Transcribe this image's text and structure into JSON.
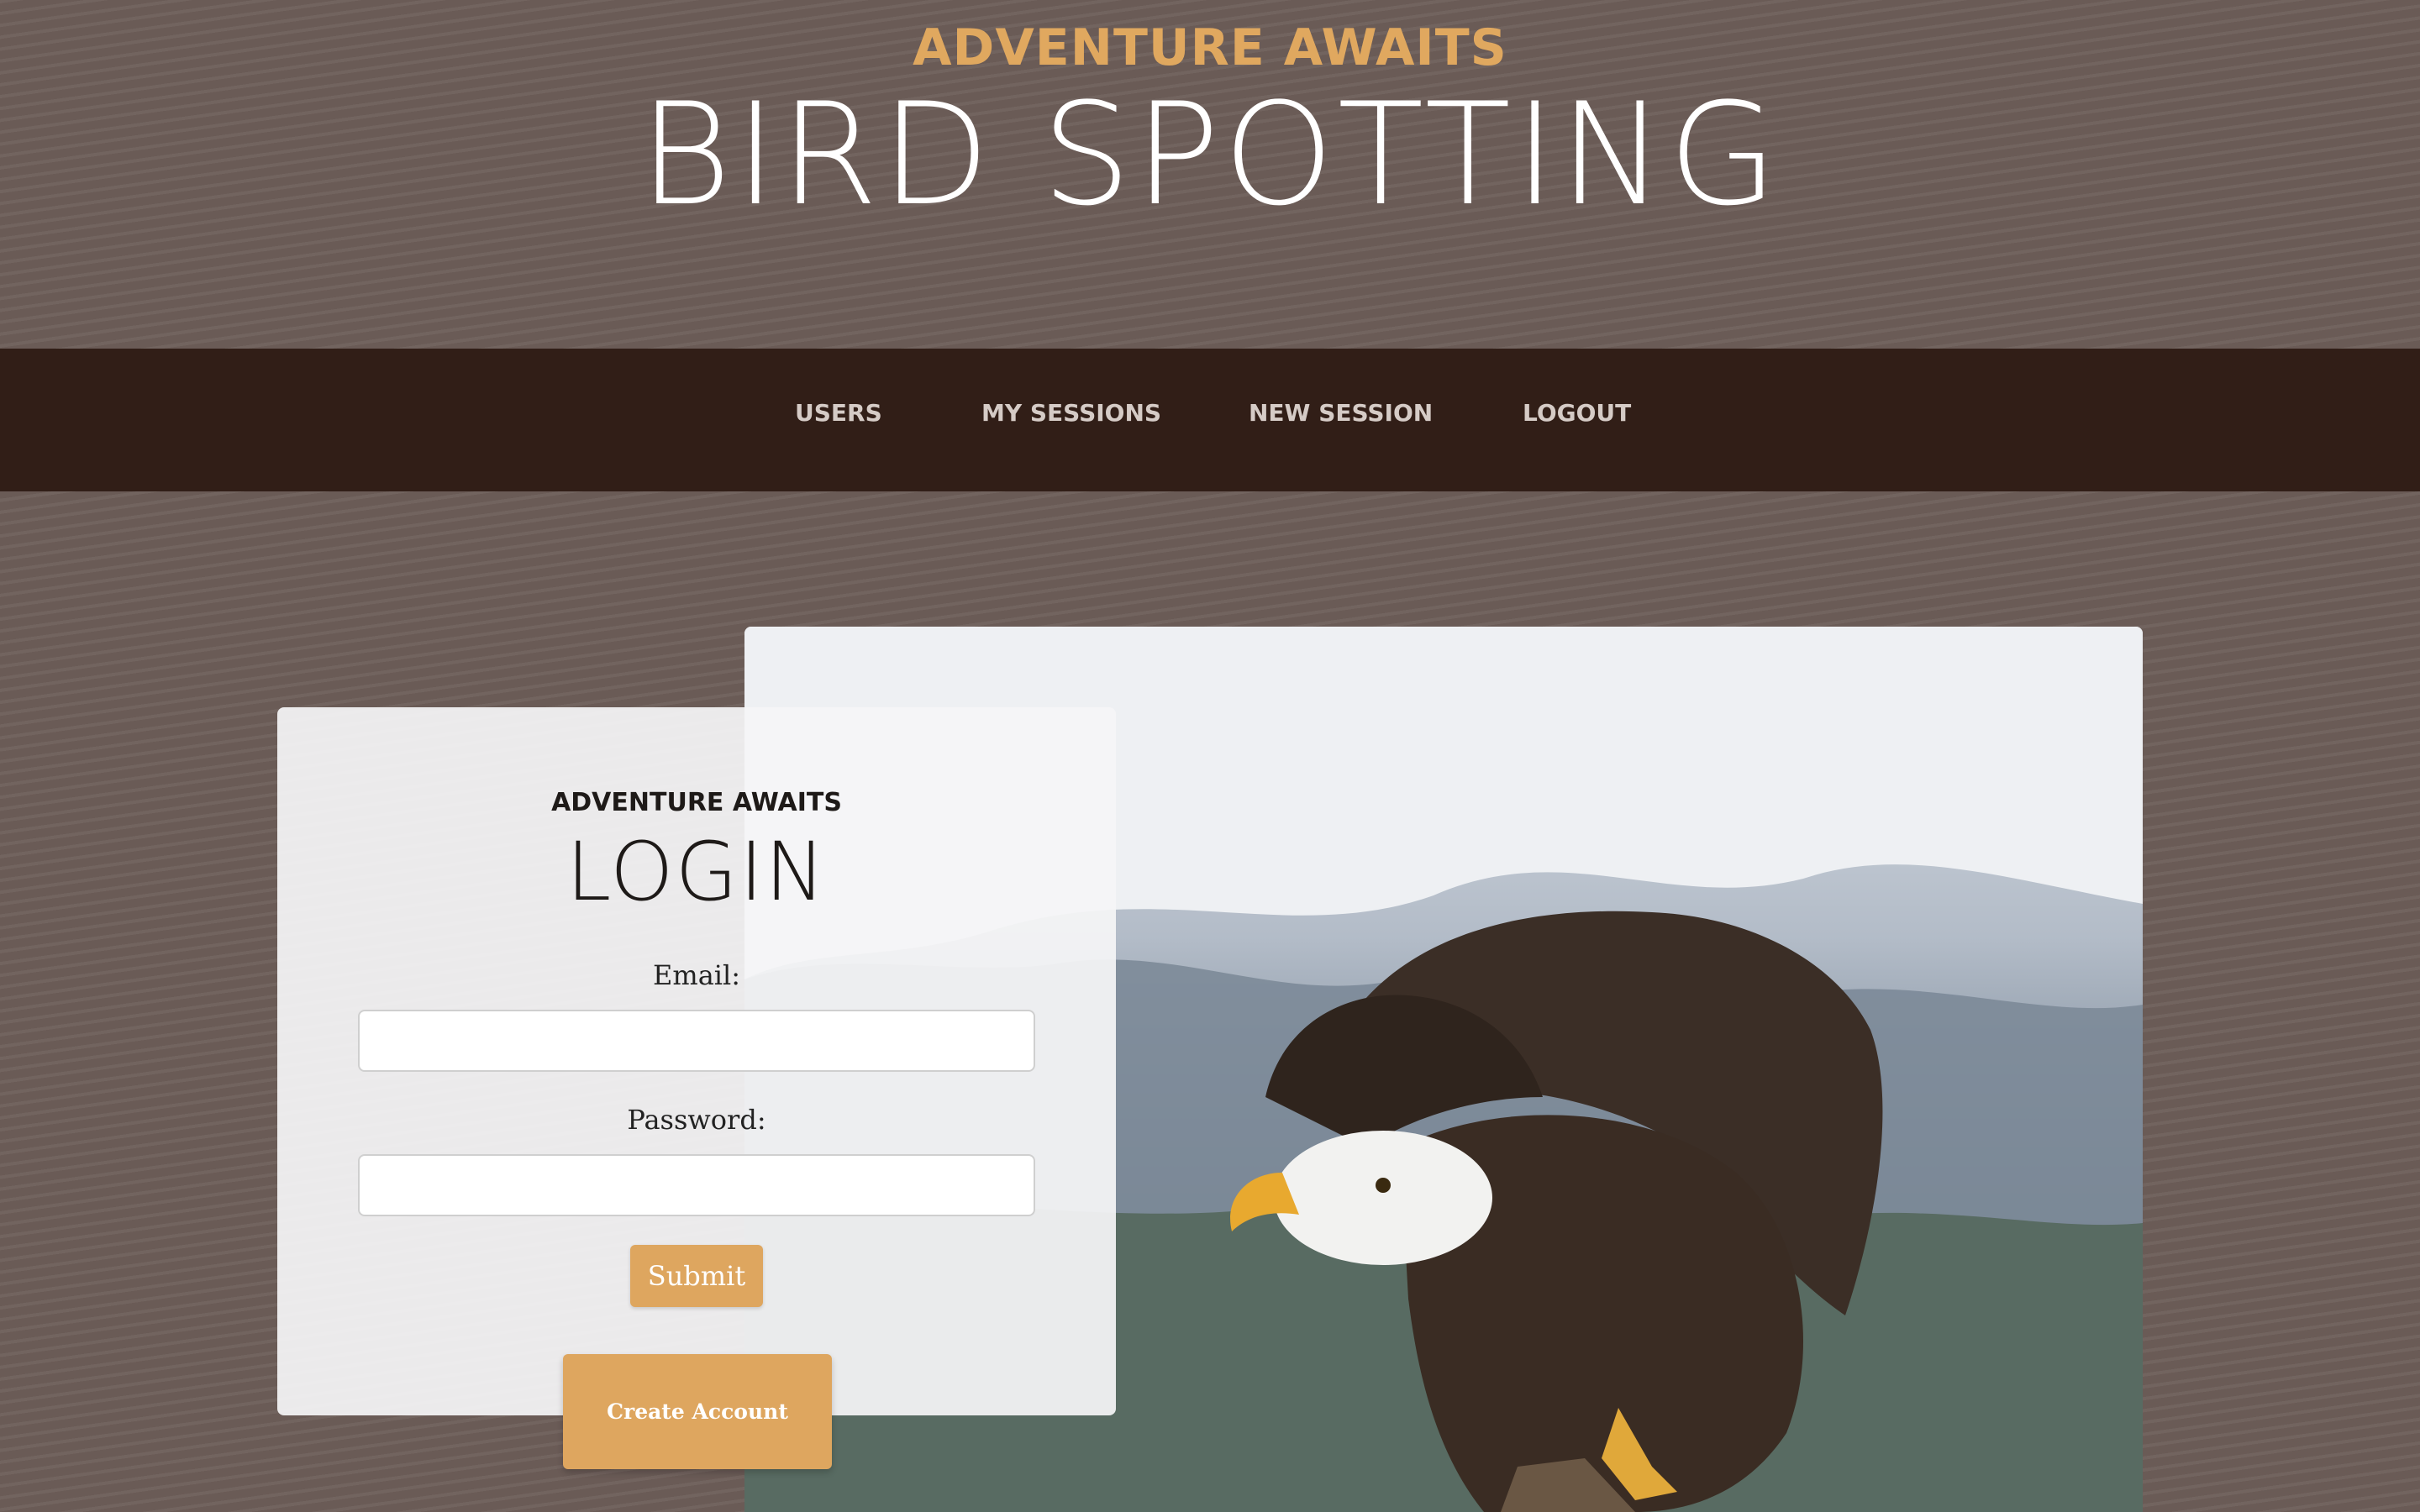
{
  "header": {
    "kicker": "ADVENTURE AWAITS",
    "title": "BIRD SPOTTING"
  },
  "nav": {
    "items": [
      {
        "label": "USERS"
      },
      {
        "label": "MY SESSIONS"
      },
      {
        "label": "NEW SESSION"
      },
      {
        "label": "LOGOUT"
      }
    ]
  },
  "login": {
    "kicker": "ADVENTURE AWAITS",
    "title": "LOGIN",
    "email_label": "Email:",
    "email_value": "",
    "password_label": "Password:",
    "password_value": "",
    "submit_label": "Submit",
    "create_account_label": "Create Account"
  },
  "hero_image": {
    "subject": "bald eagle perched in front of snowy mountains"
  },
  "colors": {
    "accent": "#dea65f",
    "background": "#6d5e59",
    "navbar": "#311e17"
  }
}
